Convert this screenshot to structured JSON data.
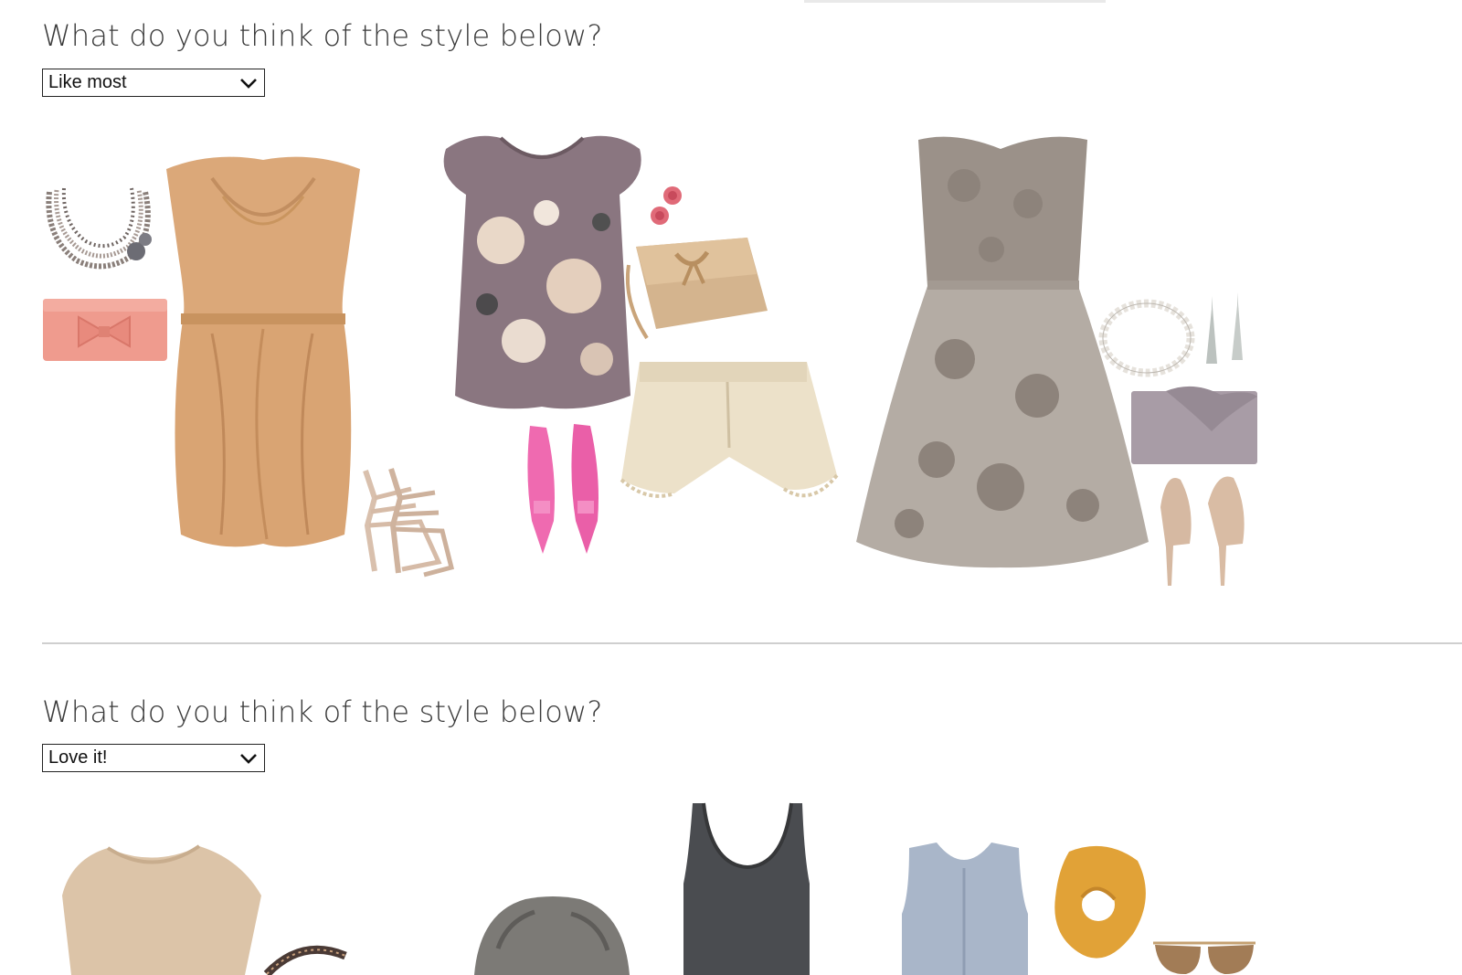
{
  "survey": {
    "questions": [
      {
        "prompt": "What do you think of the style below?",
        "selected_option": "Like most",
        "outfits": [
          {
            "items": [
              "beaded-necklace-icon",
              "pink-bow-clutch-icon",
              "tan-draped-dress-icon",
              "strappy-nude-heels-icon"
            ]
          },
          {
            "items": [
              "floral-blouse-icon",
              "rose-earrings-icon",
              "gold-clutch-icon",
              "lace-shorts-icon",
              "pink-pumps-icon"
            ]
          },
          {
            "items": [
              "grey-lace-dress-icon",
              "pearl-bracelet-icon",
              "drop-earrings-icon",
              "lilac-ruffle-clutch-icon",
              "metallic-heels-icon"
            ]
          }
        ]
      },
      {
        "prompt": "What do you think of the style below?",
        "selected_option": "Love it!",
        "outfits": [
          {
            "items": [
              "beige-top-icon",
              "belt-icon"
            ]
          },
          {
            "items": [
              "grey-knit-cardigan-icon",
              "charcoal-tank-icon"
            ]
          },
          {
            "items": [
              "blue-sleeveless-blouse-icon",
              "mustard-scarf-icon",
              "aviator-sunglasses-icon"
            ]
          }
        ]
      }
    ]
  },
  "colors": {
    "divider": "#cfcfcf",
    "text": "#3a3a3a",
    "select_border": "#222222"
  }
}
